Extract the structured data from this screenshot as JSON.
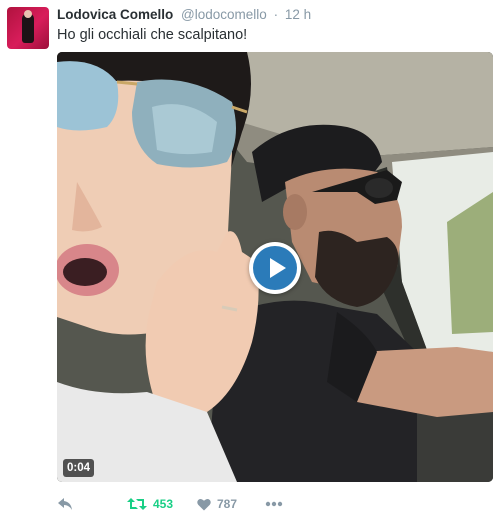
{
  "tweet": {
    "author_name": "Lodovica Comello",
    "author_handle": "@lodocomello",
    "separator": "·",
    "time": "12 h",
    "text": "Ho gli occhiali che scalpitano!"
  },
  "video": {
    "duration": "0:04",
    "play_icon": "play-icon"
  },
  "actions": {
    "reply_icon": "reply-icon",
    "retweet_icon": "retweet-icon",
    "retweet_count": "453",
    "like_icon": "heart-icon",
    "like_count": "787",
    "more_icon": "more-icon"
  },
  "colors": {
    "retweet_active": "#19cf86",
    "icon_gray": "#8899a6",
    "play_blue": "#2b7bb9"
  }
}
